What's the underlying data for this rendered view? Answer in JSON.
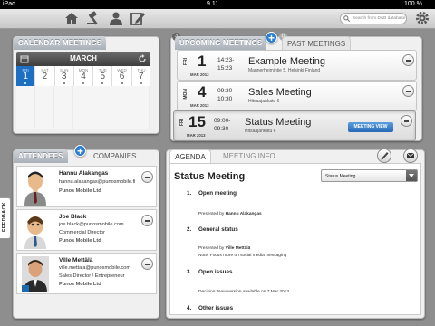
{
  "status_bar": {
    "carrier": "iPad",
    "time": "9.11",
    "battery": "100 %"
  },
  "toolbar": {
    "search_placeholder": "Search from D&B database"
  },
  "calendar": {
    "tab_label": "CALENDAR MEETINGS",
    "month": "MARCH",
    "days": [
      {
        "dow": "FRI",
        "num": "1"
      },
      {
        "dow": "SAT",
        "num": "2"
      },
      {
        "dow": "SUN",
        "num": "3"
      },
      {
        "dow": "MON",
        "num": "4"
      },
      {
        "dow": "TUE",
        "num": "5"
      },
      {
        "dow": "WED",
        "num": "6"
      },
      {
        "dow": "THU",
        "num": "7"
      }
    ]
  },
  "meetings": {
    "tab_upcoming": "UPCOMING MEETINGS",
    "upcoming_count": "3",
    "past_count": "11",
    "tab_past": "PAST MEETINGS",
    "items": [
      {
        "dow": "FRI",
        "day": "1",
        "month": "MAR 2013",
        "start": "14:23-",
        "end": "15:23",
        "title": "Example Meeting",
        "address": "Mannerheimintie 5, Helsinki Finland"
      },
      {
        "dow": "MON",
        "day": "4",
        "month": "MAR 2013",
        "start": "09:30-",
        "end": "10:30",
        "title": "Sales Meeting",
        "address": "Hitsaajankatu 6"
      },
      {
        "dow": "FRI",
        "day": "15",
        "month": "MAR 2013",
        "start": "09:00-",
        "end": "09:30",
        "title": "Status Meeting",
        "address": "Hitsaajankatu 6",
        "action": "MEETING VIEW"
      }
    ]
  },
  "attendees": {
    "tab_attendees": "ATTENDEES",
    "tab_companies": "COMPANIES",
    "feedback_label": "FEEDBACK",
    "items": [
      {
        "name": "Hannu Alakangas",
        "email": "hannu.alakangas@punosmobile.fi",
        "title": "",
        "company": "Punos Mobile Ltd"
      },
      {
        "name": "Joe Black",
        "email": "joe.black@punosmobile.com",
        "title": "Commercial Director",
        "company": "Punos Mobile Ltd"
      },
      {
        "name": "Ville Mettälä",
        "email": "ville.mettala@punosmobile.com",
        "title": "Sales Director / Entrepreneur",
        "company": "Punos Mobile Ltd"
      }
    ]
  },
  "agenda": {
    "tab_agenda": "AGENDA",
    "tab_info": "MEETING INFO",
    "title": "Status Meeting",
    "select_value": "Status Meeting",
    "items": [
      {
        "num": "1.",
        "heading": "Open meeting",
        "sub_label": "Presented by",
        "sub_value": "Hannu Alakangas"
      },
      {
        "num": "2.",
        "heading": "General status",
        "sub_label": "Presented by",
        "sub_value": "Ville Mettälä",
        "note": "Note: Focus more on social media messaging"
      },
      {
        "num": "3.",
        "heading": "Open issues",
        "note": "Decision: New version available on 7 Mar 2013"
      },
      {
        "num": "4.",
        "heading": "Other issues"
      }
    ]
  }
}
